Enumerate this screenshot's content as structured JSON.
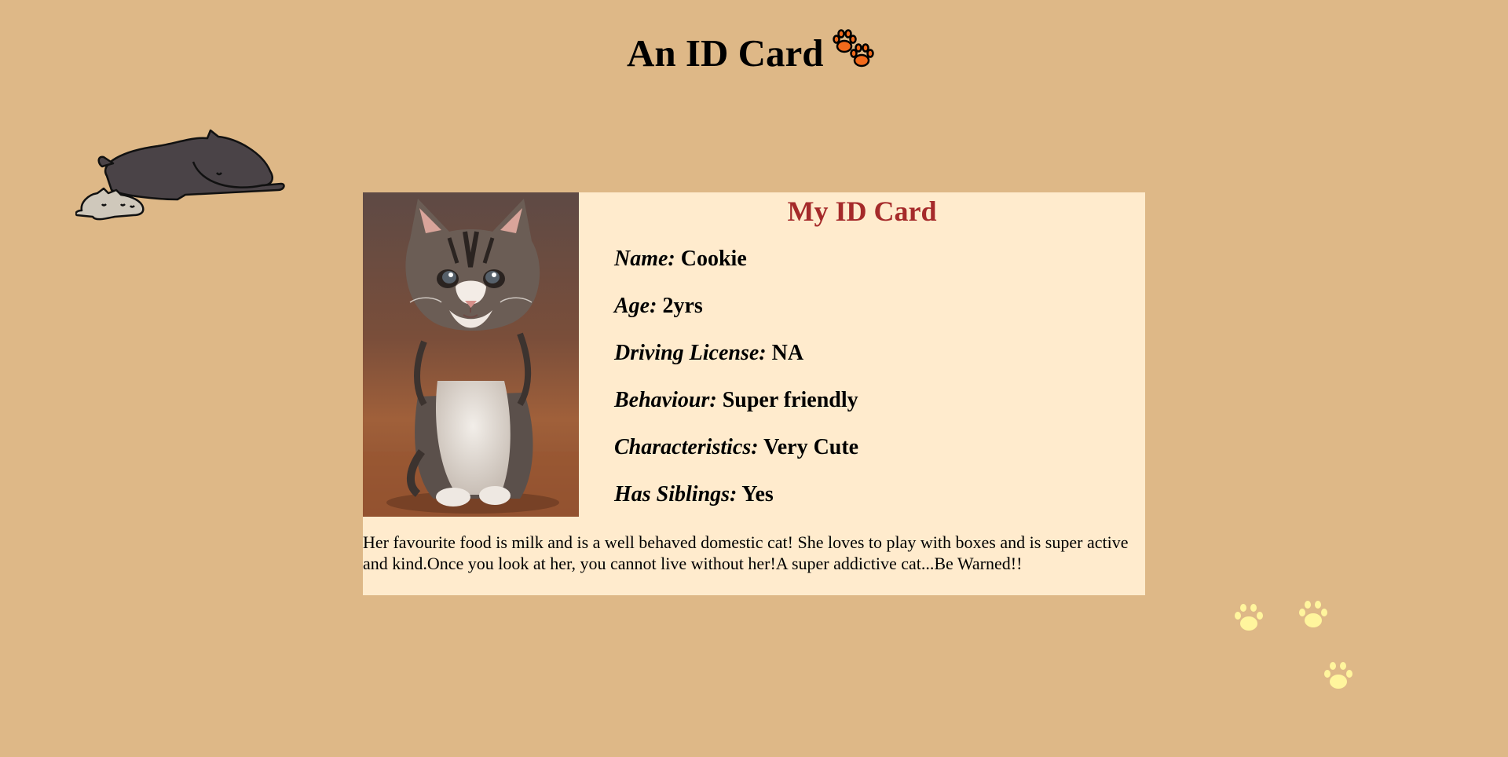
{
  "page": {
    "title": "An ID Card",
    "title_icon": "paw-icon",
    "background_color": "#deb887"
  },
  "decorations": {
    "cats_icon": "sleeping-cats-icon",
    "paw_print_icon": "paw-print-icon",
    "paw_color": "#fff59d"
  },
  "card": {
    "heading": "My ID Card",
    "heading_color": "#a52a2a",
    "background_color": "#ffebcd",
    "photo_icon": "kitten-photo",
    "details": [
      {
        "label": "Name:",
        "value": "Cookie"
      },
      {
        "label": "Age:",
        "value": "2yrs"
      },
      {
        "label": "Driving License:",
        "value": "NA"
      },
      {
        "label": "Behaviour:",
        "value": "Super friendly"
      },
      {
        "label": "Characteristics:",
        "value": "Very Cute"
      },
      {
        "label": "Has Siblings:",
        "value": "Yes"
      }
    ],
    "description": "Her favourite food is milk and is a well behaved domestic cat! She loves to play with boxes and is super active and kind.Once you look at her, you cannot live without her!A super addictive cat...Be Warned!!"
  }
}
